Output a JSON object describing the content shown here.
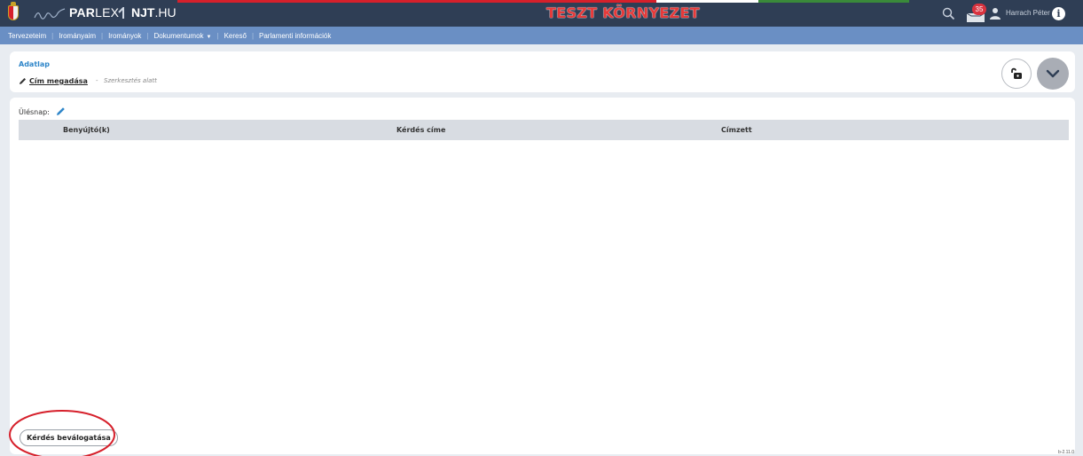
{
  "header": {
    "logo_parlex_bold": "PAR",
    "logo_parlex_rest": "LEX",
    "logo_njt_bold": "NJT",
    "logo_njt_rest": ".HU",
    "env_title": "TESZT KÖRNYEZET",
    "inbox_count": "35",
    "user_name": "Harrach Péter",
    "icons": [
      "crest-icon",
      "search-icon",
      "inbox-icon",
      "user-icon",
      "info-icon"
    ]
  },
  "nav": {
    "items": [
      "Tervezeteim",
      "Irományaim",
      "Irományok",
      "Dokumentumok",
      "Kereső",
      "Parlamenti információk"
    ]
  },
  "adatlap": {
    "title": "Adatlap",
    "link": "Cím megadása",
    "separator": "-",
    "status": "Szerkesztés alatt"
  },
  "main": {
    "ules_label": "Ülésnap:",
    "columns": [
      "Benyújtó(k)",
      "Kérdés címe",
      "Címzett"
    ],
    "rows": [],
    "select_button": "Kérdés beválogatása"
  },
  "footer": {
    "version": "b-2.11.0"
  },
  "colors": {
    "header_bg": "#2f3e55",
    "nav_bg": "#6a8fc4",
    "env_title": "#e63a3a",
    "badge": "#d9333f",
    "highlight_ring": "#d6202b"
  }
}
